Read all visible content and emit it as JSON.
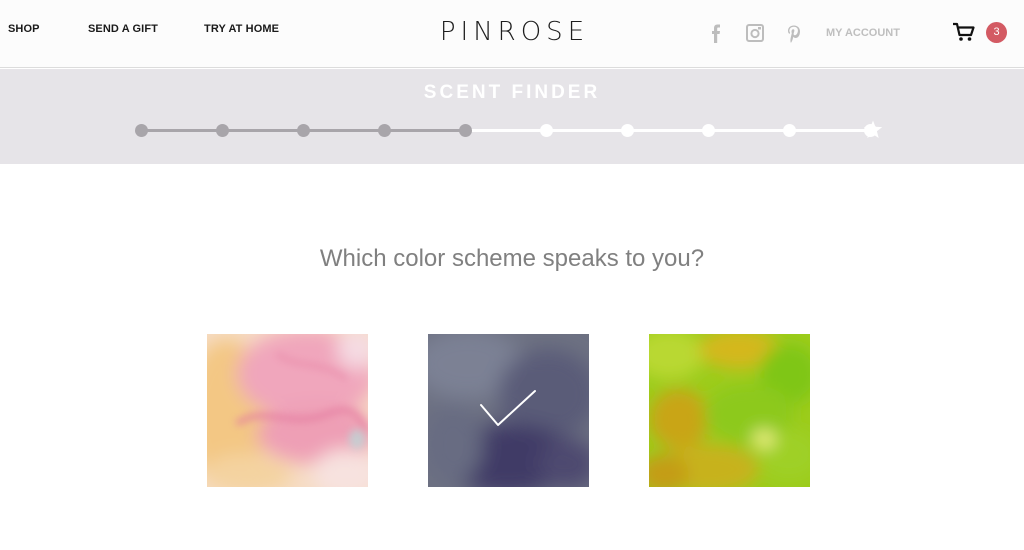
{
  "header": {
    "nav": {
      "shop": "SHOP",
      "send_gift": "SEND A GIFT",
      "try_home": "TRY AT HOME"
    },
    "logo": "PINROSE",
    "social_icons": [
      "facebook-icon",
      "instagram-icon",
      "pinterest-icon"
    ],
    "account_label": "MY ACCOUNT",
    "cart_count": "3"
  },
  "finder": {
    "title": "SCENT FINDER",
    "steps_total": 10,
    "current_step": 5,
    "final_marker": "star-icon"
  },
  "quiz": {
    "question": "Which color scheme speaks to you?",
    "options": [
      {
        "id": "pink-watercolor",
        "selected": false
      },
      {
        "id": "purple-watercolor",
        "selected": true
      },
      {
        "id": "green-watercolor",
        "selected": false
      }
    ]
  },
  "colors": {
    "progress_done": "#a8a5aa",
    "progress_todo": "#ffffff",
    "finder_bg": "#e6e4e8",
    "cart_badge": "#d35a63",
    "question_text": "#808080"
  }
}
